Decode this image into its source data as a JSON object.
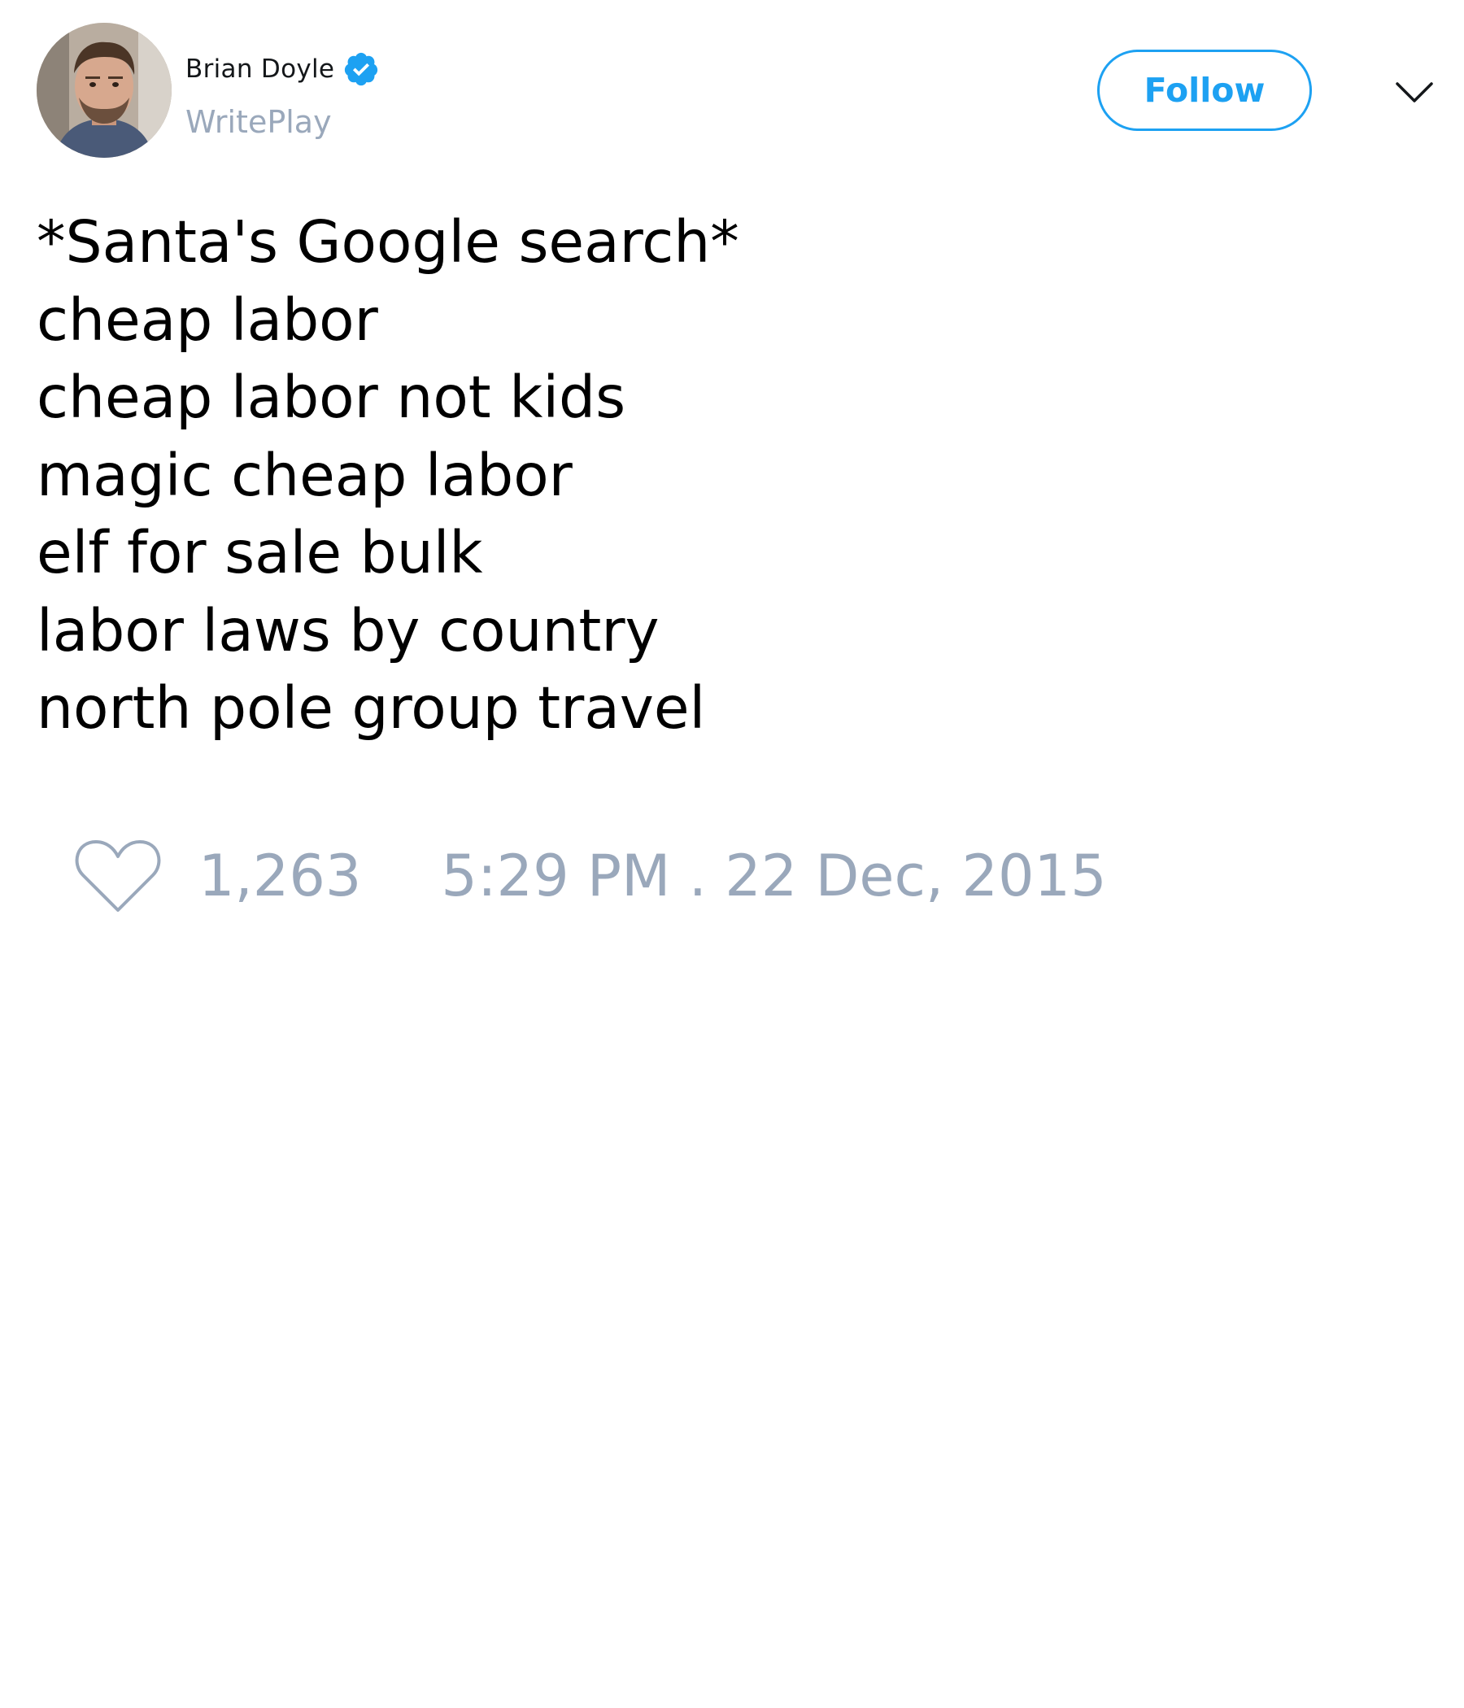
{
  "author": {
    "display_name": "Brian Doyle",
    "handle": "WritePlay",
    "verified": true,
    "avatar_icon": "avatar-photo"
  },
  "actions": {
    "follow_label": "Follow",
    "menu_icon": "chevron-down-icon"
  },
  "tweet": {
    "lines": [
      "*Santa's Google search*",
      "cheap labor",
      "cheap labor not kids",
      "magic cheap labor",
      "elf for sale bulk",
      "labor laws by country",
      "north pole group travel"
    ]
  },
  "footer": {
    "like_icon": "heart-icon",
    "like_count": "1,263",
    "timestamp": "5:29 PM . 22 Dec, 2015"
  },
  "colors": {
    "accent": "#1da1f2",
    "muted": "#9aa8bb",
    "text": "#000000"
  }
}
